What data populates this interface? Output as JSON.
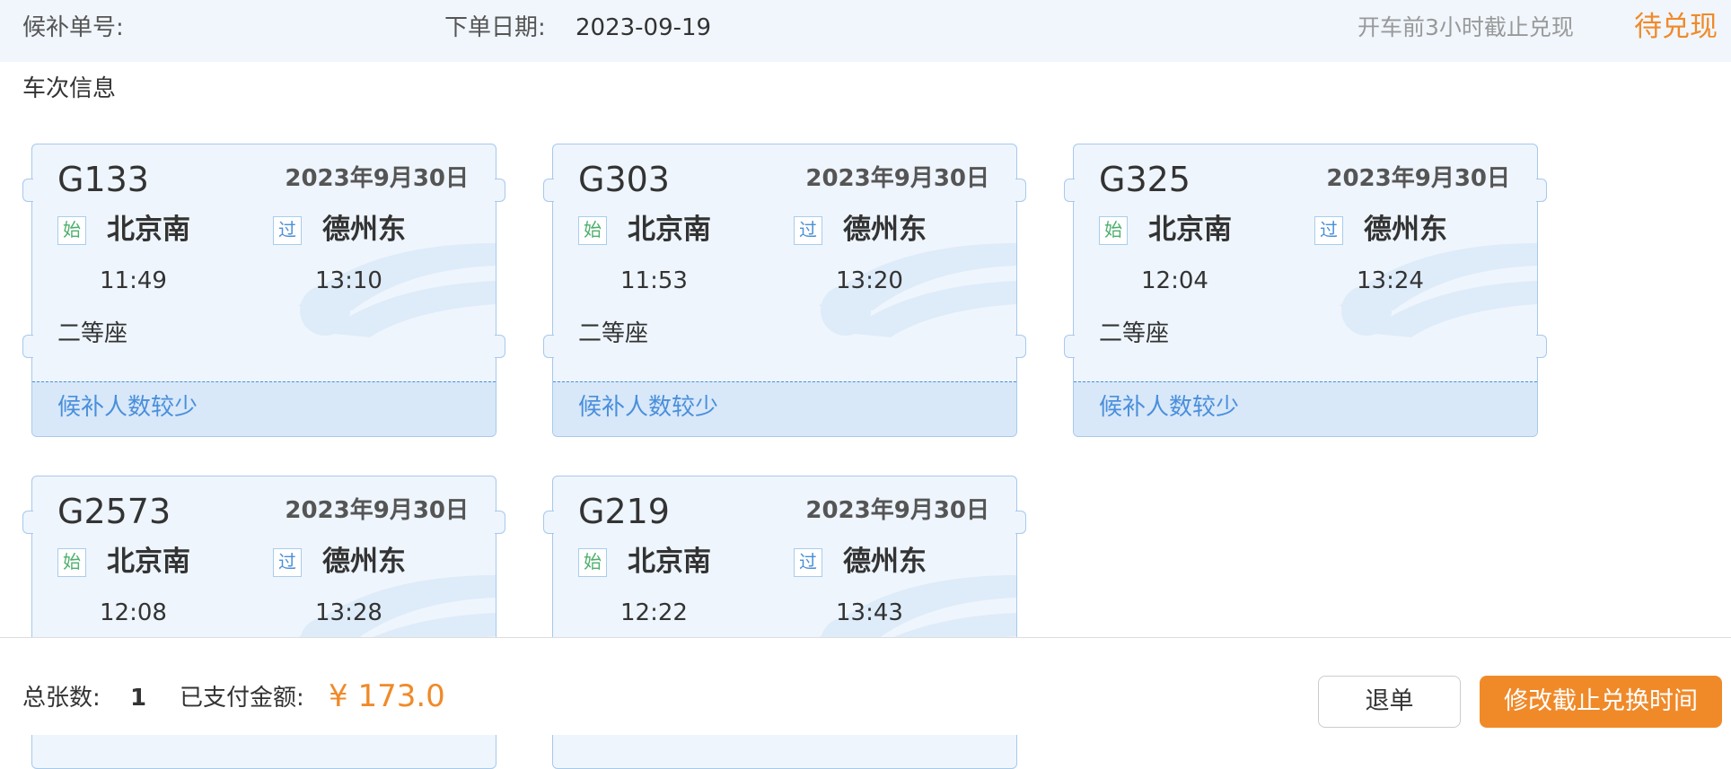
{
  "header": {
    "order_no_label": "候补单号:",
    "order_date_label": "下单日期:",
    "order_date_value": "2023-09-19",
    "deadline_note": "开车前3小时截止兑现",
    "status": "待兑现"
  },
  "section_title": "车次信息",
  "trains": [
    {
      "no": "G133",
      "date": "2023年9月30日",
      "start_badge": "始",
      "start_station": "北京南",
      "start_time": "11:49",
      "pass_badge": "过",
      "pass_station": "德州东",
      "pass_time": "13:10",
      "seat": "二等座",
      "queue": "候补人数较少"
    },
    {
      "no": "G303",
      "date": "2023年9月30日",
      "start_badge": "始",
      "start_station": "北京南",
      "start_time": "11:53",
      "pass_badge": "过",
      "pass_station": "德州东",
      "pass_time": "13:20",
      "seat": "二等座",
      "queue": "候补人数较少"
    },
    {
      "no": "G325",
      "date": "2023年9月30日",
      "start_badge": "始",
      "start_station": "北京南",
      "start_time": "12:04",
      "pass_badge": "过",
      "pass_station": "德州东",
      "pass_time": "13:24",
      "seat": "二等座",
      "queue": "候补人数较少"
    },
    {
      "no": "G2573",
      "date": "2023年9月30日",
      "start_badge": "始",
      "start_station": "北京南",
      "start_time": "12:08",
      "pass_badge": "过",
      "pass_station": "德州东",
      "pass_time": "13:28",
      "seat": "",
      "queue": ""
    },
    {
      "no": "G219",
      "date": "2023年9月30日",
      "start_badge": "始",
      "start_station": "北京南",
      "start_time": "12:22",
      "pass_badge": "过",
      "pass_station": "德州东",
      "pass_time": "13:43",
      "seat": "",
      "queue": ""
    }
  ],
  "footer": {
    "total_label": "总张数:",
    "total_value": "1",
    "paid_label": "已支付金额:",
    "paid_amount": "¥ 173.0",
    "cancel_button": "退单",
    "modify_button": "修改截止兑换时间"
  },
  "colors": {
    "accent_orange": "#f08a29",
    "link_blue": "#4a8fdb",
    "card_bg": "#eef5fd",
    "header_bg": "#f0f6fc"
  },
  "icons": {
    "watermark": "train-logo-watermark"
  }
}
